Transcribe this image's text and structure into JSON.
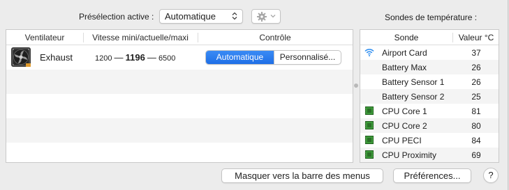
{
  "preset": {
    "label": "Présélection active :",
    "value": "Automatique",
    "chevron_icon": "chevron-updown-icon",
    "action_icon": "gear-icon"
  },
  "fans": {
    "columns": [
      "Ventilateur",
      "Vitesse mini/actuelle/maxi",
      "Contrôle"
    ],
    "rows": [
      {
        "icon": "fan-icon",
        "name": "Exhaust",
        "min": "1200",
        "current": "1196",
        "max": "6500",
        "separator": "—",
        "control_options": [
          "Automatique",
          "Personnalisé..."
        ],
        "control_selected": "Automatique"
      }
    ]
  },
  "sensors": {
    "title": "Sondes de température :",
    "columns": [
      "Sonde",
      "Valeur °C"
    ],
    "rows": [
      {
        "icon": "wifi-icon",
        "name": "Airport Card",
        "value": "37"
      },
      {
        "icon": "",
        "name": "Battery Max",
        "value": "26"
      },
      {
        "icon": "",
        "name": "Battery Sensor 1",
        "value": "26"
      },
      {
        "icon": "",
        "name": "Battery Sensor 2",
        "value": "25"
      },
      {
        "icon": "chip-icon",
        "name": "CPU Core 1",
        "value": "81"
      },
      {
        "icon": "chip-icon",
        "name": "CPU Core 2",
        "value": "80"
      },
      {
        "icon": "chip-icon",
        "name": "CPU PECI",
        "value": "84"
      },
      {
        "icon": "chip-icon",
        "name": "CPU Proximity",
        "value": "69"
      }
    ]
  },
  "buttons": {
    "menu_bar": "Masquer vers la barre des menus",
    "preferences": "Préférences...",
    "help": "?"
  },
  "colors": {
    "accent": "#1f6fe6",
    "chip_green": "#3d9a3a",
    "wifi_blue": "#2a8cf0"
  }
}
